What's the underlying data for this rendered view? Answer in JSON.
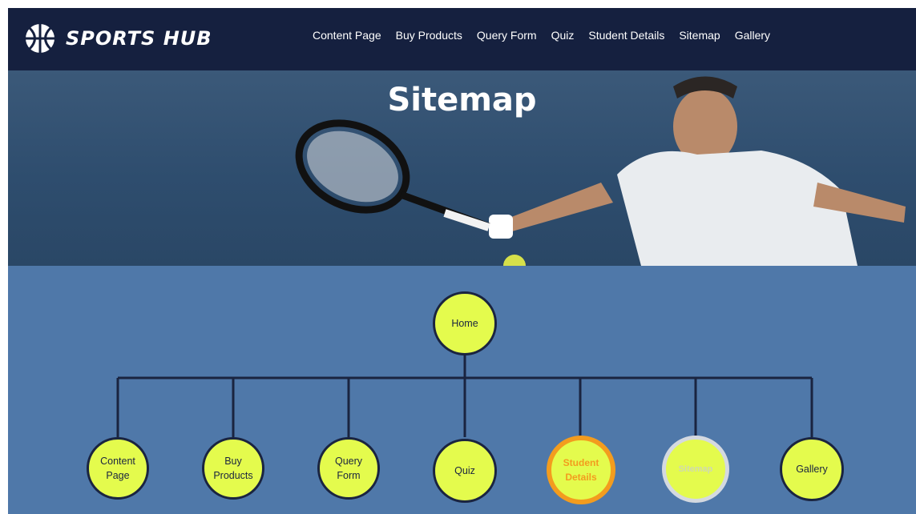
{
  "brand": {
    "name": "SPORTS HUB"
  },
  "nav": {
    "items": [
      {
        "label": "Content Page"
      },
      {
        "label": "Buy Products"
      },
      {
        "label": "Query Form"
      },
      {
        "label": "Quiz"
      },
      {
        "label": "Student Details"
      },
      {
        "label": "Sitemap"
      },
      {
        "label": "Gallery"
      }
    ]
  },
  "hero": {
    "title": "Sitemap"
  },
  "sitemap": {
    "root": {
      "label": "Home"
    },
    "children": [
      {
        "label": "Content Page"
      },
      {
        "label": "Buy Products"
      },
      {
        "label": "Query Form"
      },
      {
        "label": "Quiz"
      },
      {
        "label": "Student Details"
      },
      {
        "label": "Sitemap"
      },
      {
        "label": "Gallery"
      }
    ]
  },
  "colors": {
    "header_bg": "#15203f",
    "sitemap_bg": "#4f78a9",
    "node_fill": "#e4fb4d",
    "node_border": "#1a2440",
    "active_orange": "#f39c1e",
    "active_grey": "#d4d9e0"
  }
}
